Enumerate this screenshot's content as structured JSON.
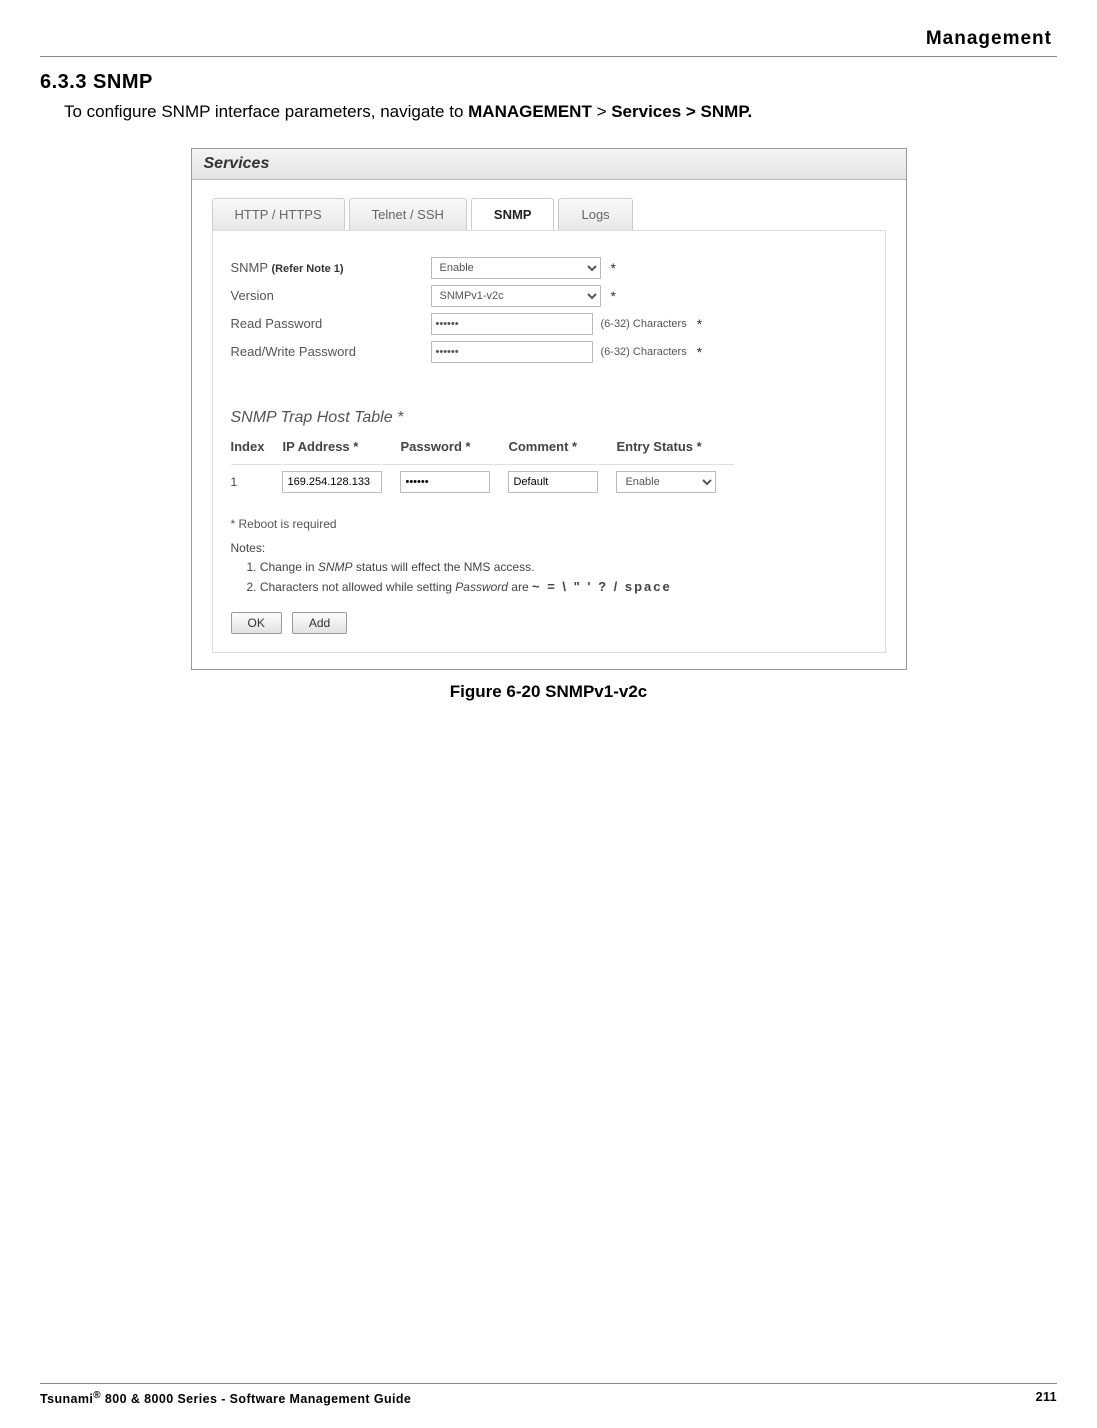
{
  "header": {
    "running": "Management"
  },
  "section": {
    "heading": "6.3.3 SNMP",
    "intro_pre": "To configure SNMP interface parameters, navigate to ",
    "intro_bold1": "MANAGEMENT",
    "intro_mid": " > ",
    "intro_bold2": "Services > SNMP."
  },
  "panel": {
    "title": "Services",
    "tabs": [
      "HTTP / HTTPS",
      "Telnet / SSH",
      "SNMP",
      "Logs"
    ],
    "active_tab_index": 2,
    "form": {
      "snmp_label": "SNMP",
      "snmp_note_ref": "(Refer Note 1)",
      "snmp_value": "Enable",
      "version_label": "Version",
      "version_value": "SNMPv1-v2c",
      "read_pw_label": "Read Password",
      "read_pw_value": "••••••",
      "read_pw_hint": "(6-32) Characters",
      "rw_pw_label": "Read/Write Password",
      "rw_pw_value": "••••••",
      "rw_pw_hint": "(6-32) Characters",
      "star": "*"
    },
    "trap": {
      "title": "SNMP Trap Host Table *",
      "headers": [
        "Index",
        "IP Address *",
        "Password *",
        "Comment *",
        "Entry Status *"
      ],
      "row": {
        "index": "1",
        "ip": "169.254.128.133",
        "pw": "••••••",
        "comment": "Default",
        "status": "Enable"
      }
    },
    "reboot": "* Reboot is required",
    "notes": {
      "label": "Notes:",
      "n1_pre": "1. Change in ",
      "n1_em": "SNMP",
      "n1_post": " status will effect the NMS access.",
      "n2_pre": "2. Characters not allowed while setting ",
      "n2_em": "Password",
      "n2_post": " are    ",
      "n2_sym": "~ = \\ \" ' ? / space"
    },
    "buttons": {
      "ok": "OK",
      "add": "Add"
    }
  },
  "figure_caption": "Figure 6-20 SNMPv1-v2c",
  "footer": {
    "left_pre": "Tsunami",
    "left_reg": "®",
    "left_post": " 800 & 8000 Series - Software Management Guide",
    "page": "211"
  }
}
